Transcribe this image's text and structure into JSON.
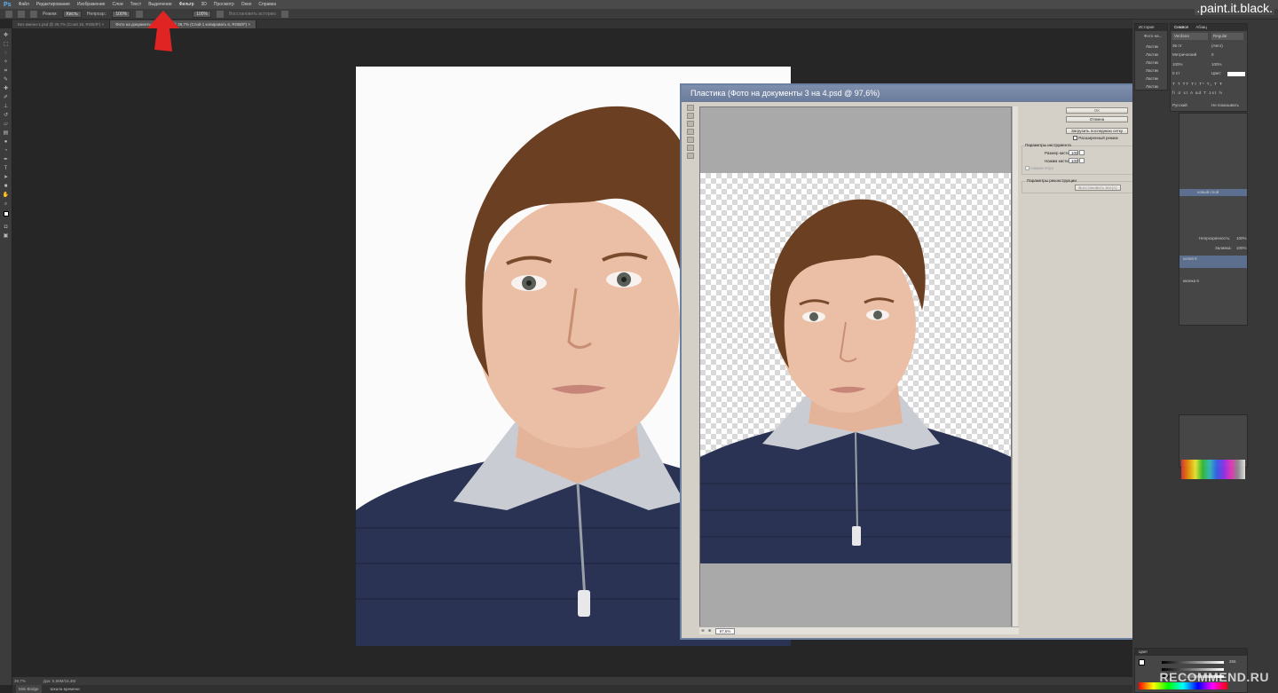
{
  "app": {
    "logo": "Ps",
    "menu": [
      "Файл",
      "Редактирование",
      "Изображение",
      "Слои",
      "Текст",
      "Выделение",
      "Фильтр",
      "3D",
      "Просмотр",
      "Окно",
      "Справка"
    ],
    "active_menu_index": 6,
    "window_controls": [
      "–",
      "□",
      "✕"
    ]
  },
  "options_bar": {
    "mode_label": "Режим:",
    "mode_value": "Кисть",
    "opacity_label": "Непрозр.:",
    "opacity_value": "100%",
    "pressure_value": "100%",
    "history_label": "Восстановить историю"
  },
  "tabs": [
    {
      "label": "Без имени-1.psd @ 39,7% (Слой 18, RGB/8*) ×",
      "active": false
    },
    {
      "label": "Фото на документы 3 на 4.psd @ 39,7% (Слой 1 копировать 6, RGB/8*) ×",
      "active": true
    }
  ],
  "liquify": {
    "title": "Пластика (Фото на документы 3 на 4.psd @ 97,6%)",
    "ok_label": "OK",
    "cancel_label": "Отмена",
    "load_mesh_label": "Загрузить последнюю сетку",
    "advanced_mode_label": "Расширенный режим",
    "tool_options_title": "Параметры инструмента",
    "brush_size_label": "Размер кисти:",
    "brush_size_value": "100",
    "brush_pressure_label": "Нажим кисти:",
    "brush_pressure_value": "100",
    "stylus_label": "Нажим пера",
    "reconstruct_title": "Параметры реконструкции",
    "restore_all_label": "Восстановить все(A)",
    "zoom_value": "97,6%"
  },
  "history_panel": {
    "tabs": [
      "История",
      "Символ",
      "Абзац"
    ],
    "snapshot_label": "Фото на...",
    "items": [
      "Ластик",
      "Ластик",
      "Ластик",
      "Ластик",
      "Ластик",
      "Ластик"
    ]
  },
  "character_panel": {
    "font": "Verdana",
    "style": "Regular",
    "size": "36 пт",
    "leading": "(Авто)",
    "kerning": "Метрический",
    "tracking": "0",
    "vscale": "100%",
    "hscale": "100%",
    "baseline": "0 пт",
    "color_label": "Цвет:",
    "lang": "Русский",
    "aa": "Не показывать"
  },
  "layers_panel": {
    "opacity_label": "Непрозрачность:",
    "opacity_value": "100%",
    "fill_label": "Заливка:",
    "fill_value": "100%",
    "layer_1": "новый слой",
    "layer_2": "копия 6",
    "layer_3": "иконка 6"
  },
  "status": {
    "zoom": "39,7%",
    "doc": "Док: 5,99M/15,4M"
  },
  "bottom_tabs": [
    "Mini Bridge",
    "Шкала времени"
  ],
  "color_panel": {
    "label": "Цвет",
    "value": "255"
  },
  "watermark": ".paint.it.black.",
  "recommend": "RECOMMEND.RU"
}
